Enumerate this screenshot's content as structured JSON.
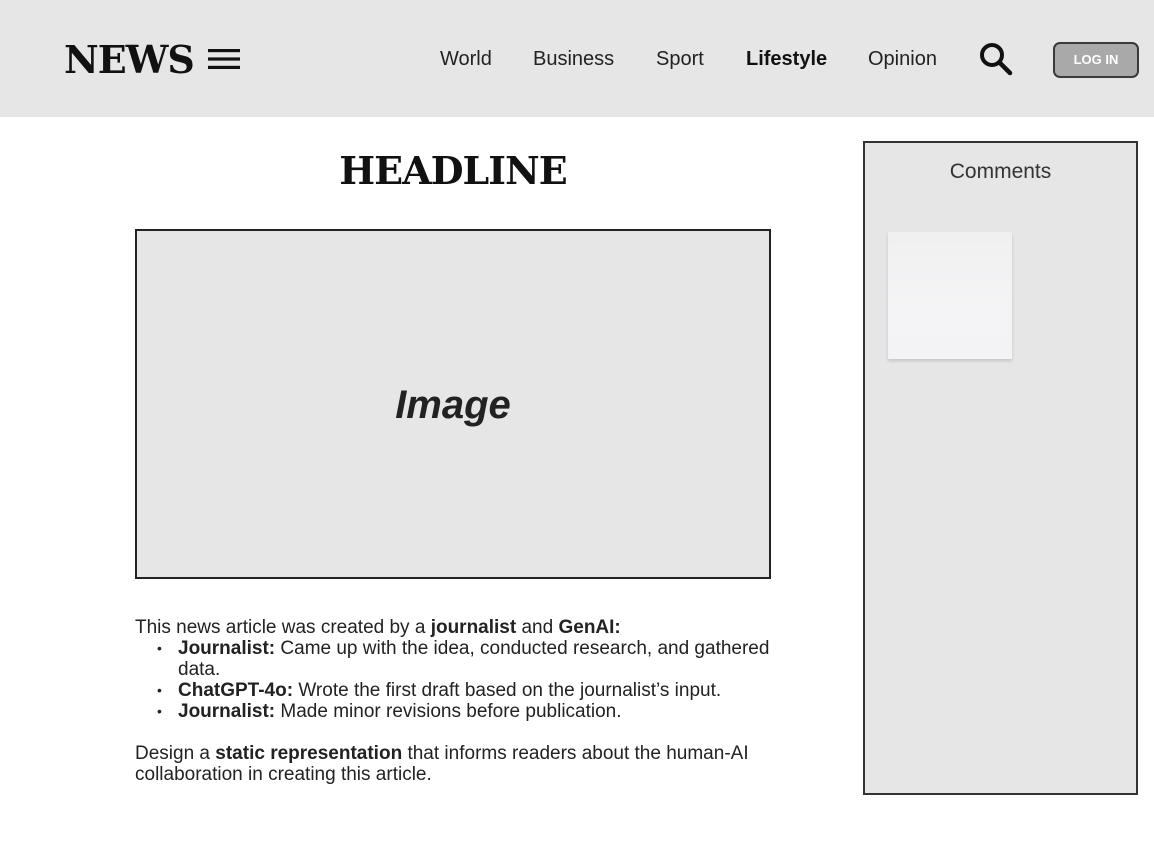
{
  "header": {
    "logo": "NEWS",
    "nav": [
      {
        "label": "World"
      },
      {
        "label": "Business"
      },
      {
        "label": "Sport"
      },
      {
        "label": "Lifestyle",
        "active": true
      },
      {
        "label": "Opinion"
      }
    ],
    "login_label": "LOG IN",
    "icons": {
      "menu": "hamburger-menu-icon",
      "search": "search-icon"
    }
  },
  "main": {
    "headline": "HEADLINE",
    "image_label": "Image",
    "intro": {
      "prefix": "This news article was created by a ",
      "bold1": "journalist",
      "mid": " and ",
      "bold2": "GenAI:"
    },
    "contributions": [
      {
        "role": "Journalist:",
        "text": " Came up with the idea, conducted research, and gathered data."
      },
      {
        "role": "ChatGPT-4o:",
        "text": " Wrote the first draft based on the journalist’s input."
      },
      {
        "role": "Journalist:",
        "text": " Made minor revisions before publication."
      }
    ],
    "task": {
      "prefix": "Design a ",
      "bold": "static representation",
      "suffix": " that informs readers about the human-AI collaboration in creating this article."
    }
  },
  "sidebar": {
    "title": "Comments"
  },
  "colors": {
    "header_bg": "#e6e6e6",
    "panel_bg": "#e6e6e6",
    "login_bg": "#a9a9a9"
  }
}
